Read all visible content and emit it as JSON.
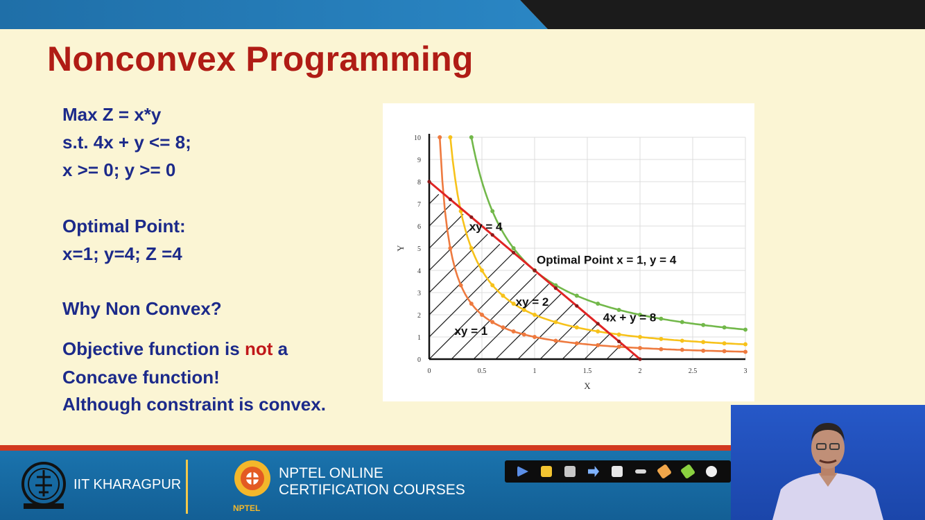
{
  "slide": {
    "title": "Nonconvex Programming",
    "problem": [
      "Max Z = x*y",
      "s.t. 4x + y <= 8;",
      "x >= 0; y >= 0"
    ],
    "optimal_heading": "Optimal Point:",
    "optimal_values": "x=1; y=4; Z =4",
    "why_heading": "Why Non Convex?",
    "explanation_line1_a": "Objective function is ",
    "explanation_line1_b": "not",
    "explanation_line1_c": " a",
    "explanation_line2": "Concave function!",
    "explanation_line3": "Although constraint is convex."
  },
  "chart_data": {
    "type": "line",
    "xlabel": "X",
    "ylabel": "Y",
    "xlim": [
      0,
      3
    ],
    "ylim": [
      0,
      10
    ],
    "x_ticks": [
      "0",
      "0.5",
      "1",
      "1.5",
      "2",
      "2.5",
      "3"
    ],
    "y_ticks": [
      "0",
      "1",
      "2",
      "3",
      "4",
      "5",
      "6",
      "7",
      "8",
      "9",
      "10"
    ],
    "grid": true,
    "series": [
      {
        "name": "xy = 1",
        "color": "#ee7a3f",
        "x": [
          0.1,
          0.2,
          0.3,
          0.4,
          0.5,
          0.6,
          0.7,
          0.8,
          0.9,
          1.0,
          1.2,
          1.4,
          1.6,
          1.8,
          2.0,
          2.2,
          2.4,
          2.6,
          2.8,
          3.0
        ],
        "y": [
          10,
          5,
          3.33,
          2.5,
          2,
          1.67,
          1.43,
          1.25,
          1.11,
          1,
          0.83,
          0.71,
          0.63,
          0.56,
          0.5,
          0.45,
          0.42,
          0.38,
          0.36,
          0.33
        ]
      },
      {
        "name": "xy = 2",
        "color": "#f7c21a",
        "x": [
          0.2,
          0.3,
          0.4,
          0.5,
          0.6,
          0.7,
          0.8,
          0.9,
          1.0,
          1.2,
          1.4,
          1.6,
          1.8,
          2.0,
          2.2,
          2.4,
          2.6,
          2.8,
          3.0
        ],
        "y": [
          10,
          6.67,
          5,
          4,
          3.33,
          2.86,
          2.5,
          2.22,
          2,
          1.67,
          1.43,
          1.25,
          1.11,
          1,
          0.91,
          0.83,
          0.77,
          0.71,
          0.67
        ]
      },
      {
        "name": "xy = 4",
        "color": "#72b84a",
        "x": [
          0.4,
          0.6,
          0.8,
          1.0,
          1.2,
          1.4,
          1.6,
          1.8,
          2.0,
          2.2,
          2.4,
          2.6,
          2.8,
          3.0
        ],
        "y": [
          10,
          6.67,
          5,
          4,
          3.33,
          2.86,
          2.5,
          2.22,
          2,
          1.82,
          1.67,
          1.54,
          1.43,
          1.33
        ]
      },
      {
        "name": "4x + y = 8",
        "color": "#e02424",
        "x": [
          0,
          0.2,
          0.4,
          0.6,
          0.8,
          1.0,
          1.2,
          1.4,
          1.6,
          1.8,
          2.0
        ],
        "y": [
          8,
          7.2,
          6.4,
          5.6,
          4.8,
          4,
          3.2,
          2.4,
          1.6,
          0.8,
          0
        ]
      }
    ],
    "annotations": [
      "xy = 4",
      "Optimal Point x = 1, y = 4",
      "xy = 2",
      "4x + y = 8",
      "xy = 1"
    ],
    "feasible_region": "hatched triangle under 4x + y = 8"
  },
  "footer": {
    "institute": "IIT KHARAGPUR",
    "nptel_line1": "NPTEL ONLINE",
    "nptel_line2": "CERTIFICATION COURSES",
    "nptel_logo_text": "NPTEL"
  },
  "toolbar_icons": [
    "pointer-icon",
    "pen-icon",
    "highlighter-icon",
    "arrow-icon",
    "eraser-icon",
    "line-icon",
    "marker-icon",
    "green-marker-icon",
    "clear-icon"
  ]
}
